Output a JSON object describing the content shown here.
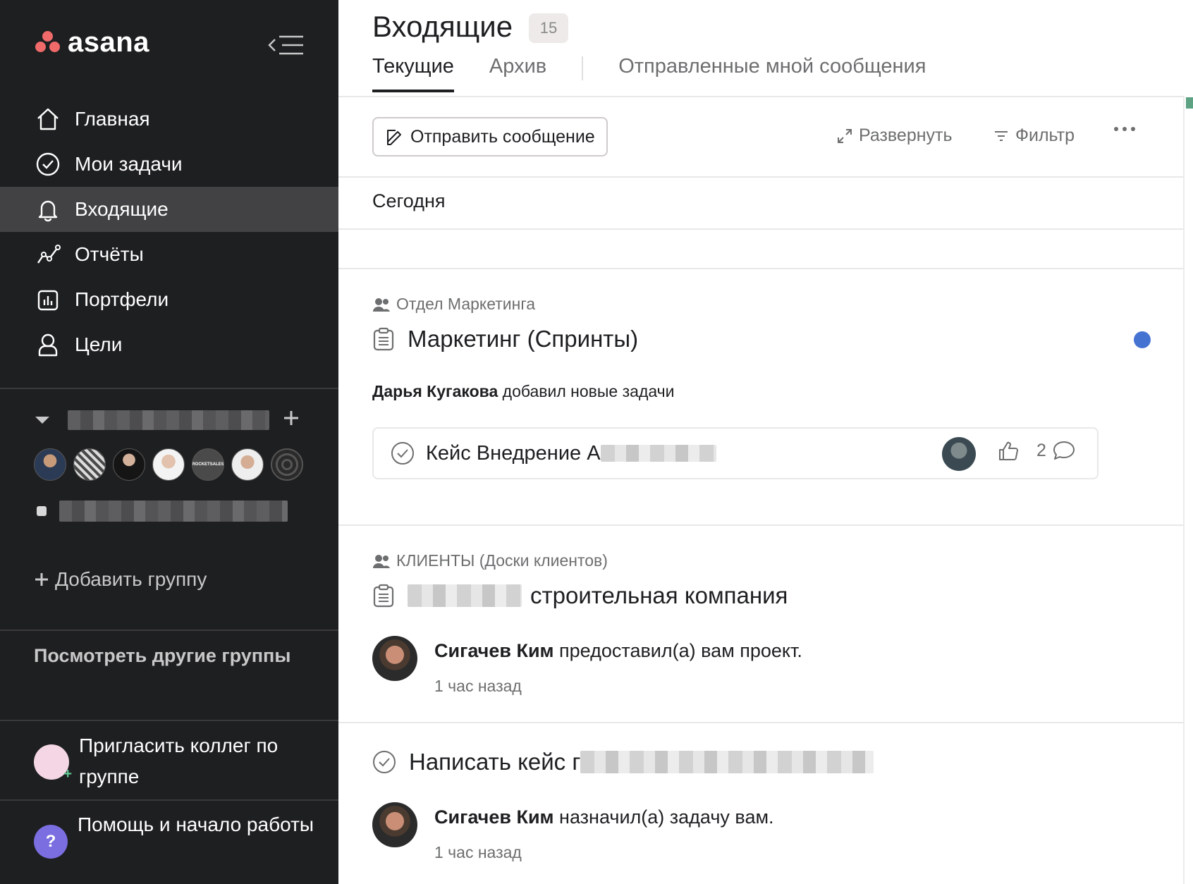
{
  "app": {
    "logo_text": "asana",
    "brand_color": "#f06a6a",
    "accent_blue": "#4573d2"
  },
  "sidebar": {
    "nav": [
      {
        "label": "Главная",
        "icon": "home-icon"
      },
      {
        "label": "Мои задачи",
        "icon": "check-circle-icon"
      },
      {
        "label": "Входящие",
        "icon": "bell-icon",
        "active": true
      },
      {
        "label": "Отчёты",
        "icon": "reports-icon"
      },
      {
        "label": "Портфели",
        "icon": "portfolio-icon"
      },
      {
        "label": "Цели",
        "icon": "goals-icon"
      }
    ],
    "add_group": "Добавить группу",
    "browse_other": "Посмотреть другие группы",
    "invite": "Пригласить коллег по группе",
    "help": "Помощь и начало работы",
    "help_icon": "?",
    "avatar_5_text": "ROCKETSALES"
  },
  "header": {
    "title": "Входящие",
    "count": "15",
    "tabs": [
      {
        "label": "Текущие",
        "active": true
      },
      {
        "label": "Архив"
      },
      {
        "label": "Отправленные мной сообщения"
      }
    ]
  },
  "toolbar": {
    "send_message": "Отправить сообщение",
    "expand": "Развернуть",
    "filter": "Фильтр"
  },
  "feed": {
    "section_title": "Сегодня",
    "item1": {
      "team": "Отдел Маркетинга",
      "project": "Маркетинг (Спринты)",
      "actor": "Дарья Кугакова",
      "action": "добавил новые задачи",
      "task_name": "Кейс Внедрение A",
      "comments": "2"
    },
    "item2": {
      "team": "КЛИЕНТЫ (Доски клиентов)",
      "project_suffix": "строительная компания",
      "actor": "Сигачев Ким",
      "action": "предоставил(а) вам проект.",
      "time": "1 час назад"
    },
    "item3": {
      "task_prefix": "Написать кейс г",
      "actor": "Сигачев Ким",
      "action": "назначил(а) задачу вам.",
      "time": "1 час назад"
    }
  }
}
